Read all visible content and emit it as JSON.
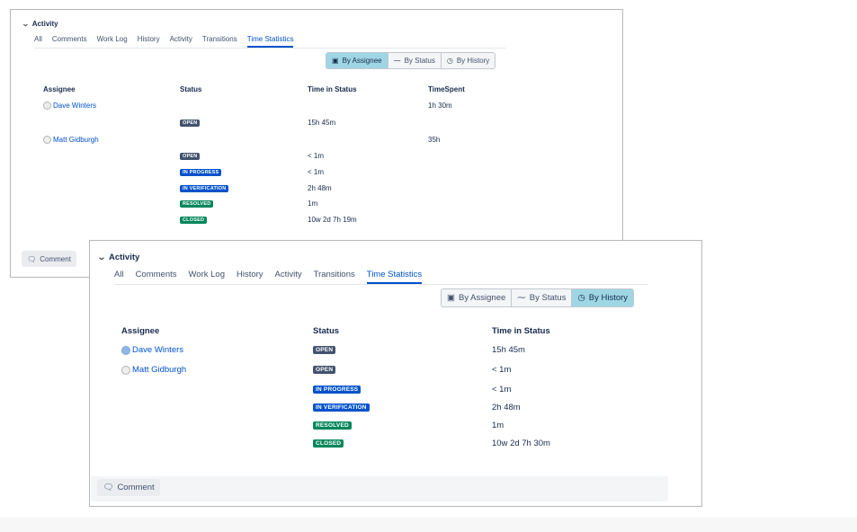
{
  "panel_by_assignee": {
    "section_title": "Activity",
    "tabs": [
      "All",
      "Comments",
      "Work Log",
      "History",
      "Activity",
      "Transitions",
      "Time Statistics"
    ],
    "active_tab": "Time Statistics",
    "view_buttons": [
      "By Assignee",
      "By Status",
      "By History"
    ],
    "selected_view": "By Assignee",
    "headers": [
      "Assignee",
      "Status",
      "Time in Status",
      "TimeSpent"
    ],
    "rows": [
      {
        "assignee": "Dave Winters",
        "status": "",
        "time": "",
        "spent": "1h 30m"
      },
      {
        "assignee": "",
        "status": "OPEN",
        "time": "15h 45m",
        "spent": ""
      },
      {
        "assignee": "Matt Gidburgh",
        "status": "",
        "time": "",
        "spent": "35h"
      },
      {
        "assignee": "",
        "status": "OPEN",
        "time": "< 1m",
        "spent": ""
      },
      {
        "assignee": "",
        "status": "IN PROGRESS",
        "time": "< 1m",
        "spent": ""
      },
      {
        "assignee": "",
        "status": "IN VERIFICATION",
        "time": "2h 48m",
        "spent": ""
      },
      {
        "assignee": "",
        "status": "RESOLVED",
        "time": "1m",
        "spent": ""
      },
      {
        "assignee": "",
        "status": "CLOSED",
        "time": "10w 2d 7h 19m",
        "spent": ""
      }
    ],
    "comment_label": "Comment"
  },
  "panel_by_history": {
    "section_title": "Activity",
    "tabs": [
      "All",
      "Comments",
      "Work Log",
      "History",
      "Activity",
      "Transitions",
      "Time Statistics"
    ],
    "active_tab": "Time Statistics",
    "view_buttons": [
      "By Assignee",
      "By Status",
      "By History"
    ],
    "selected_view": "By History",
    "headers": [
      "Assignee",
      "Status",
      "Time in Status"
    ],
    "rows": [
      {
        "assignee": "Dave Winters",
        "status": "OPEN",
        "time": "15h 45m"
      },
      {
        "assignee": "Matt Gidburgh",
        "status": "OPEN",
        "time": "< 1m"
      },
      {
        "assignee": "",
        "status": "IN PROGRESS",
        "time": "< 1m"
      },
      {
        "assignee": "",
        "status": "IN VERIFICATION",
        "time": "2h 48m"
      },
      {
        "assignee": "",
        "status": "RESOLVED",
        "time": "1m"
      },
      {
        "assignee": "",
        "status": "CLOSED",
        "time": "10w 2d 7h 30m"
      }
    ],
    "comment_label": "Comment"
  },
  "colors": {
    "link": "#0052cc",
    "selected_button": "#9fd6e4",
    "open": "#42526e",
    "in_progress": "#0052cc",
    "resolved": "#00875a"
  }
}
